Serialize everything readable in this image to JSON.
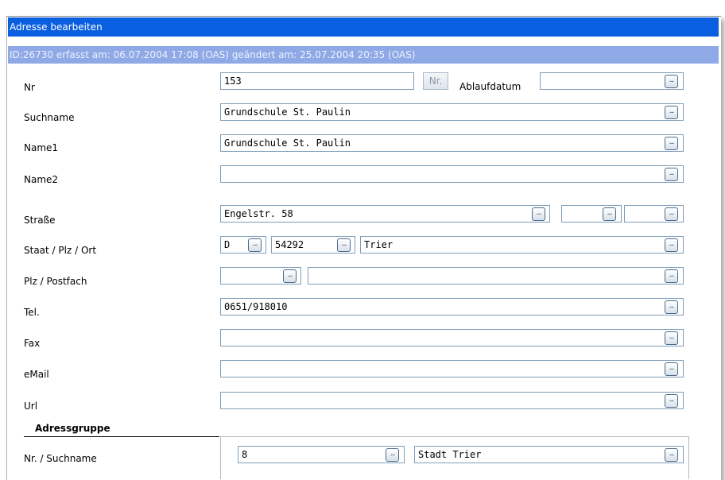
{
  "window": {
    "title": "Adresse bearbeiten",
    "info": "ID:26730   erfasst am: 06.07.2004 17:08  (OAS)    geändert am: 25.07.2004 20:35  (OAS)"
  },
  "form": {
    "nr": {
      "label": "Nr",
      "value": "153",
      "nr_button": "Nr.",
      "ablauf_label": "Ablaufdatum",
      "ablauf_value": ""
    },
    "suchname": {
      "label": "Suchname",
      "value": "Grundschule St. Paulin"
    },
    "name1": {
      "label": "Name1",
      "value": "Grundschule St. Paulin"
    },
    "name2": {
      "label": "Name2",
      "value": ""
    },
    "strasse": {
      "label": "Straße",
      "value": "Engelstr. 58",
      "extra1": "",
      "extra2": ""
    },
    "staat_plz_ort": {
      "label": "Staat / Plz / Ort",
      "staat": "D",
      "plz": "54292",
      "ort": "Trier"
    },
    "plz_postfach": {
      "label": "Plz / Postfach",
      "plz": "",
      "postfach": ""
    },
    "tel": {
      "label": "Tel.",
      "value": "0651/918010"
    },
    "fax": {
      "label": "Fax",
      "value": ""
    },
    "email": {
      "label": "eMail",
      "value": ""
    },
    "url": {
      "label": "Url",
      "value": ""
    }
  },
  "adressgruppe": {
    "title": "Adressgruppe",
    "label": "Nr. / Suchname",
    "nr": "8",
    "suchname": "Stadt Trier"
  },
  "icons": {
    "lookup": "ellipsis-icon",
    "ellipsis_glyph": "..."
  },
  "colors": {
    "titlebar": "#0a5fe0",
    "infobar": "#8fa8e6",
    "field_border": "#7f9db9"
  }
}
